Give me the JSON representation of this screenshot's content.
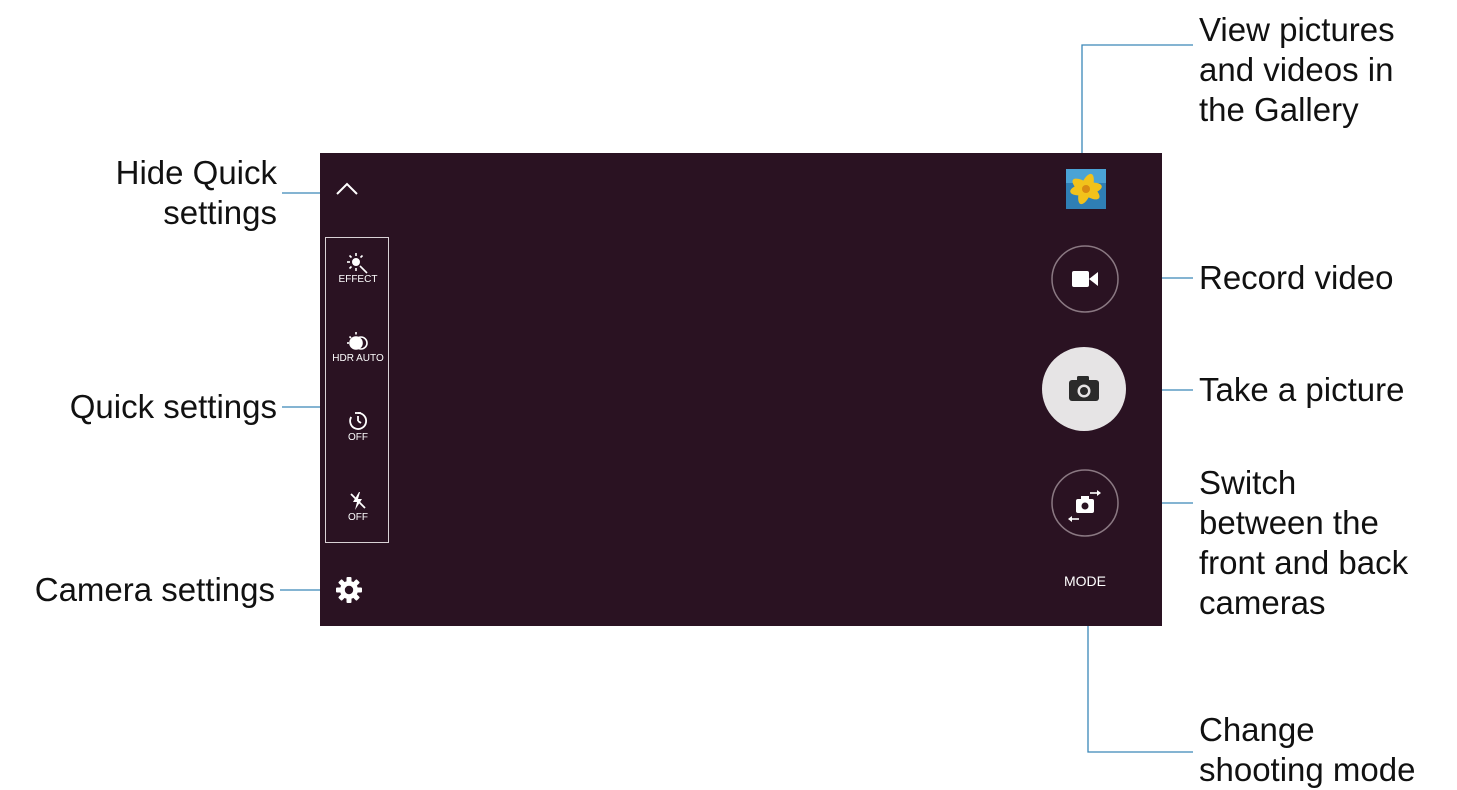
{
  "callouts": {
    "gallery": [
      "View pictures",
      "and videos in",
      "the Gallery"
    ],
    "hide_quick": [
      "Hide Quick",
      "settings"
    ],
    "record_video": [
      "Record video"
    ],
    "quick_settings": [
      "Quick settings"
    ],
    "take_picture": [
      "Take a picture"
    ],
    "switch_camera": [
      "Switch",
      "between the",
      "front and back",
      "cameras"
    ],
    "camera_settings": [
      "Camera settings"
    ],
    "change_mode": [
      "Change",
      "shooting mode"
    ]
  },
  "quick_settings": {
    "items": [
      {
        "icon": "effect-icon",
        "label": "EFFECT"
      },
      {
        "icon": "hdr-icon",
        "label": "HDR AUTO"
      },
      {
        "icon": "timer-icon",
        "label": "OFF"
      },
      {
        "icon": "flash-off-icon",
        "label": "OFF"
      }
    ]
  },
  "camera_ui": {
    "mode_label": "MODE"
  },
  "colors": {
    "viewfinder_bg": "#2a1222",
    "callout_line": "#3a87b8",
    "shutter_fill": "#e6e4e5",
    "text": "#111111"
  }
}
